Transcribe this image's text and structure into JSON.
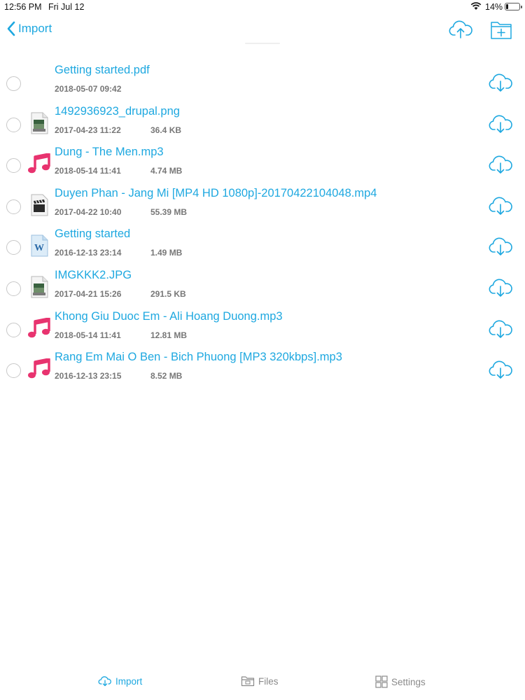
{
  "status_bar": {
    "time": "12:56 PM",
    "date": "Fri Jul 12",
    "battery": "14%",
    "battery_level": 0.14
  },
  "nav": {
    "back_label": "Import"
  },
  "files": [
    {
      "name": "Getting started.pdf",
      "date": "2018-05-07 09:42",
      "size": "",
      "icon": "none"
    },
    {
      "name": "1492936923_drupal.png",
      "date": "2017-04-23 11:22",
      "size": "36.4 KB",
      "icon": "image-file-icon"
    },
    {
      "name": "Dung - The Men.mp3",
      "date": "2018-05-14 11:41",
      "size": "4.74 MB",
      "icon": "music-note-icon"
    },
    {
      "name": "Duyen Phan - Jang Mi [MP4 HD 1080p]-20170422104048.mp4",
      "date": "2017-04-22 10:40",
      "size": "55.39 MB",
      "icon": "video-clapper-icon"
    },
    {
      "name": "Getting started",
      "date": "2016-12-13 23:14",
      "size": "1.49 MB",
      "icon": "word-document-icon"
    },
    {
      "name": "IMGKKK2.JPG",
      "date": "2017-04-21 15:26",
      "size": "291.5 KB",
      "icon": "image-file-icon"
    },
    {
      "name": "Khong Giu Duoc Em - Ali Hoang Duong.mp3",
      "date": "2018-05-14 11:41",
      "size": "12.81 MB",
      "icon": "music-note-icon"
    },
    {
      "name": "Rang Em Mai O Ben - Bich Phuong [MP3 320kbps].mp3",
      "date": "2016-12-13 23:15",
      "size": "8.52 MB",
      "icon": "music-note-icon"
    }
  ],
  "tabs": {
    "import": "Import",
    "files": "Files",
    "settings": "Settings"
  },
  "colors": {
    "accent": "#1ea8e0",
    "music": "#e8336f",
    "inactive": "#8a8a8a"
  }
}
